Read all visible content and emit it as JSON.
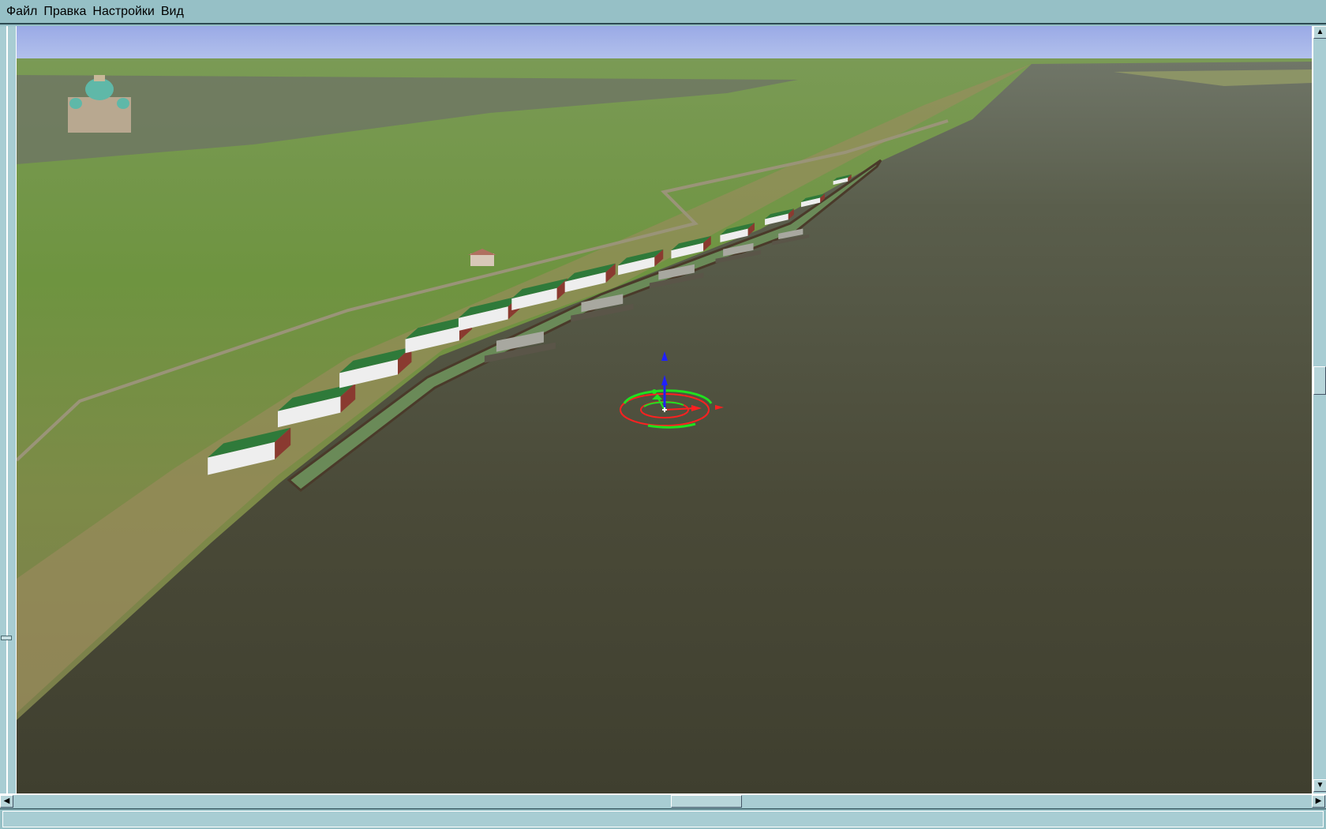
{
  "menu": {
    "items": [
      {
        "label": "Файл"
      },
      {
        "label": "Правка"
      },
      {
        "label": "Настройки"
      },
      {
        "label": "Вид"
      }
    ]
  },
  "scene": {
    "description_icons": [
      "transform-gizmo-icon"
    ],
    "building_count": 13,
    "boat_count": 5
  },
  "colors": {
    "chrome": "#96c0c6",
    "water": "#474736",
    "grass": "#6f9140",
    "sky": "#a4b4e8"
  },
  "status": {
    "text": ""
  }
}
